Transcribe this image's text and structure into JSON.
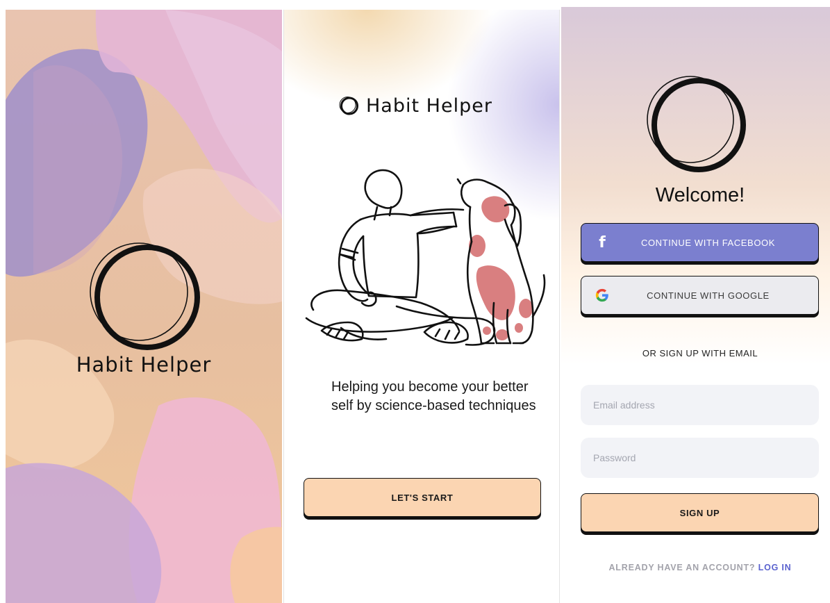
{
  "colors": {
    "accent_peach": "#fbd5b2",
    "facebook_blue": "#7b7fcf",
    "link_blue": "#5b63cf",
    "field_bg": "#f2f3f7",
    "google_btn_bg": "#ebebef"
  },
  "splash": {
    "app_name": "Habit Helper",
    "logo_icon": "double-circle-logo-icon"
  },
  "intro": {
    "brand": "Habit Helper",
    "illustration": "man-petting-dog-illustration",
    "tagline": "Helping you become your better self by science-based techniques",
    "start_button": "LET'S START"
  },
  "signup": {
    "welcome": "Welcome!",
    "facebook_button": "CONTINUE WITH FACEBOOK",
    "google_button": "CONTINUE WITH GOOGLE",
    "or_text": "OR SIGN UP WITH EMAIL",
    "email_placeholder": "Email address",
    "email_value": "",
    "password_placeholder": "Password",
    "password_value": "",
    "signup_button": "SIGN UP",
    "already_text": "ALREADY HAVE AN ACCOUNT?",
    "login_link": "LOG IN"
  }
}
